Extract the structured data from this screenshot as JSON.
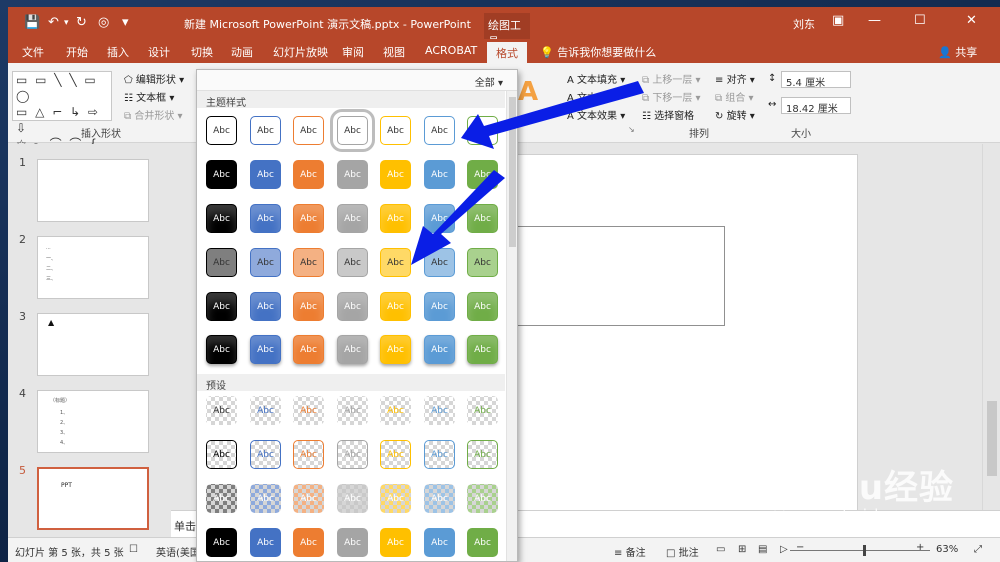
{
  "window": {
    "title": "新建 Microsoft PowerPoint 演示文稿.pptx  -  PowerPoint",
    "context_tab": "绘图工具",
    "user": "刘东"
  },
  "ribbon_tabs": [
    {
      "label": "文件"
    },
    {
      "label": "开始"
    },
    {
      "label": "插入"
    },
    {
      "label": "设计"
    },
    {
      "label": "切换"
    },
    {
      "label": "动画"
    },
    {
      "label": "幻灯片放映"
    },
    {
      "label": "审阅"
    },
    {
      "label": "视图"
    },
    {
      "label": "ACROBAT"
    },
    {
      "label": "格式",
      "active": true
    }
  ],
  "tell_me": "告诉我你想要做什么",
  "share": "共享",
  "ribbon": {
    "insert_shapes": {
      "edit_shape": "编辑形状",
      "text_box": "文本框",
      "merge_shapes": "合并形状",
      "label": "插入形状"
    },
    "wordart": {
      "text_fill": "文本填充",
      "text_outline": "文本",
      "text_effects": "文本效果"
    },
    "arrange": {
      "bring_forward": "上移一层",
      "send_backward": "下移一层",
      "selection_pane": "选择窗格",
      "align": "对齐",
      "group": "组合",
      "rotate": "旋转",
      "label": "排列"
    },
    "size": {
      "height": "5.4 厘米",
      "width": "18.42 厘米",
      "label": "大小"
    }
  },
  "gallery": {
    "filter": "全部",
    "theme_styles_header": "主题样式",
    "presets_header": "预设",
    "swatch_label": "Abc",
    "colors": [
      "#000000",
      "#4472c4",
      "#ed7d31",
      "#a5a5a5",
      "#ffc000",
      "#5b9bd5",
      "#70ad47"
    ],
    "light_colors": [
      "#7f7f7f",
      "#8faadc",
      "#f4b183",
      "#c9c9c9",
      "#ffd966",
      "#9dc3e6",
      "#a9d18e"
    ]
  },
  "slides": [
    {
      "number": "1",
      "lines": []
    },
    {
      "number": "2",
      "lines": [
        "...",
        "一、",
        "二、",
        "三、"
      ]
    },
    {
      "number": "3",
      "lines": [
        "▲"
      ]
    },
    {
      "number": "4",
      "lines": [
        "（标题）",
        "1、",
        "2、",
        "3、",
        "4、"
      ]
    },
    {
      "number": "5",
      "lines": [
        "PPT"
      ],
      "selected": true
    }
  ],
  "notes_placeholder": "单击",
  "status": {
    "slide_of": "幻灯片 第 5 张，共 5 张",
    "language": "英语(美国)",
    "notes": "备注",
    "comments": "批注",
    "zoom": "63%"
  },
  "watermark": {
    "brand": "Baidu经验",
    "url": "jingyan.baidu.com"
  },
  "accent_colors": {
    "title_bar": "#b7472a",
    "arrow": "#0a1ee6"
  }
}
